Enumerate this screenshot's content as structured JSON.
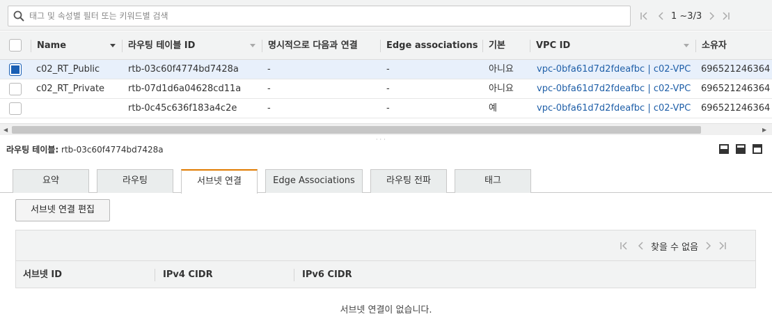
{
  "search": {
    "placeholder": "태그 및 속성별 필터 또는 키워드별 검색",
    "value": ""
  },
  "top_pager": {
    "range": "1 ~3/3"
  },
  "table": {
    "columns": {
      "name": "Name",
      "rt_id": "라우팅 테이블 ID",
      "explicit": "명시적으로 다음과 연결",
      "edge": "Edge associations",
      "main": "기본",
      "vpc": "VPC ID",
      "owner": "소유자"
    },
    "rows": [
      {
        "selected": true,
        "name": "c02_RT_Public",
        "rt_id": "rtb-03c60f4774bd7428a",
        "explicit": "-",
        "edge": "-",
        "main": "아니요",
        "vpc": "vpc-0bfa61d7d2fdeafbc | c02-VPC",
        "owner": "696521246364"
      },
      {
        "selected": false,
        "name": "c02_RT_Private",
        "rt_id": "rtb-07d1d6a04628cd11a",
        "explicit": "-",
        "edge": "-",
        "main": "아니요",
        "vpc": "vpc-0bfa61d7d2fdeafbc | c02-VPC",
        "owner": "696521246364"
      },
      {
        "selected": false,
        "name": "",
        "rt_id": "rtb-0c45c636f183a4c2e",
        "explicit": "-",
        "edge": "-",
        "main": "예",
        "vpc": "vpc-0bfa61d7d2fdeafbc | c02-VPC",
        "owner": "696521246364"
      }
    ]
  },
  "detail": {
    "label": "라우팅 테이블:",
    "value": "rtb-03c60f4774bd7428a",
    "tabs": [
      "요약",
      "라우팅",
      "서브넷 연결",
      "Edge Associations",
      "라우팅 전파",
      "태그"
    ],
    "active_tab": "서브넷 연결",
    "edit_button": "서브넷 연결 편집",
    "pager_text": "찾을 수 없음",
    "columns": [
      "서브넷 ID",
      "IPv4 CIDR",
      "IPv6 CIDR"
    ],
    "empty_message": "서브넷 연결이 없습니다."
  },
  "colors": {
    "accent_tab": "#e07b00",
    "link": "#1f5fa8",
    "selected_row": "#e8f0fb",
    "checkbox": "#1a5fb4"
  },
  "icons": [
    "search-icon",
    "first-page-icon",
    "prev-page-icon",
    "next-page-icon",
    "last-page-icon",
    "sort-caret-icon",
    "layout-bottom-icon",
    "layout-split-icon",
    "layout-top-icon"
  ]
}
